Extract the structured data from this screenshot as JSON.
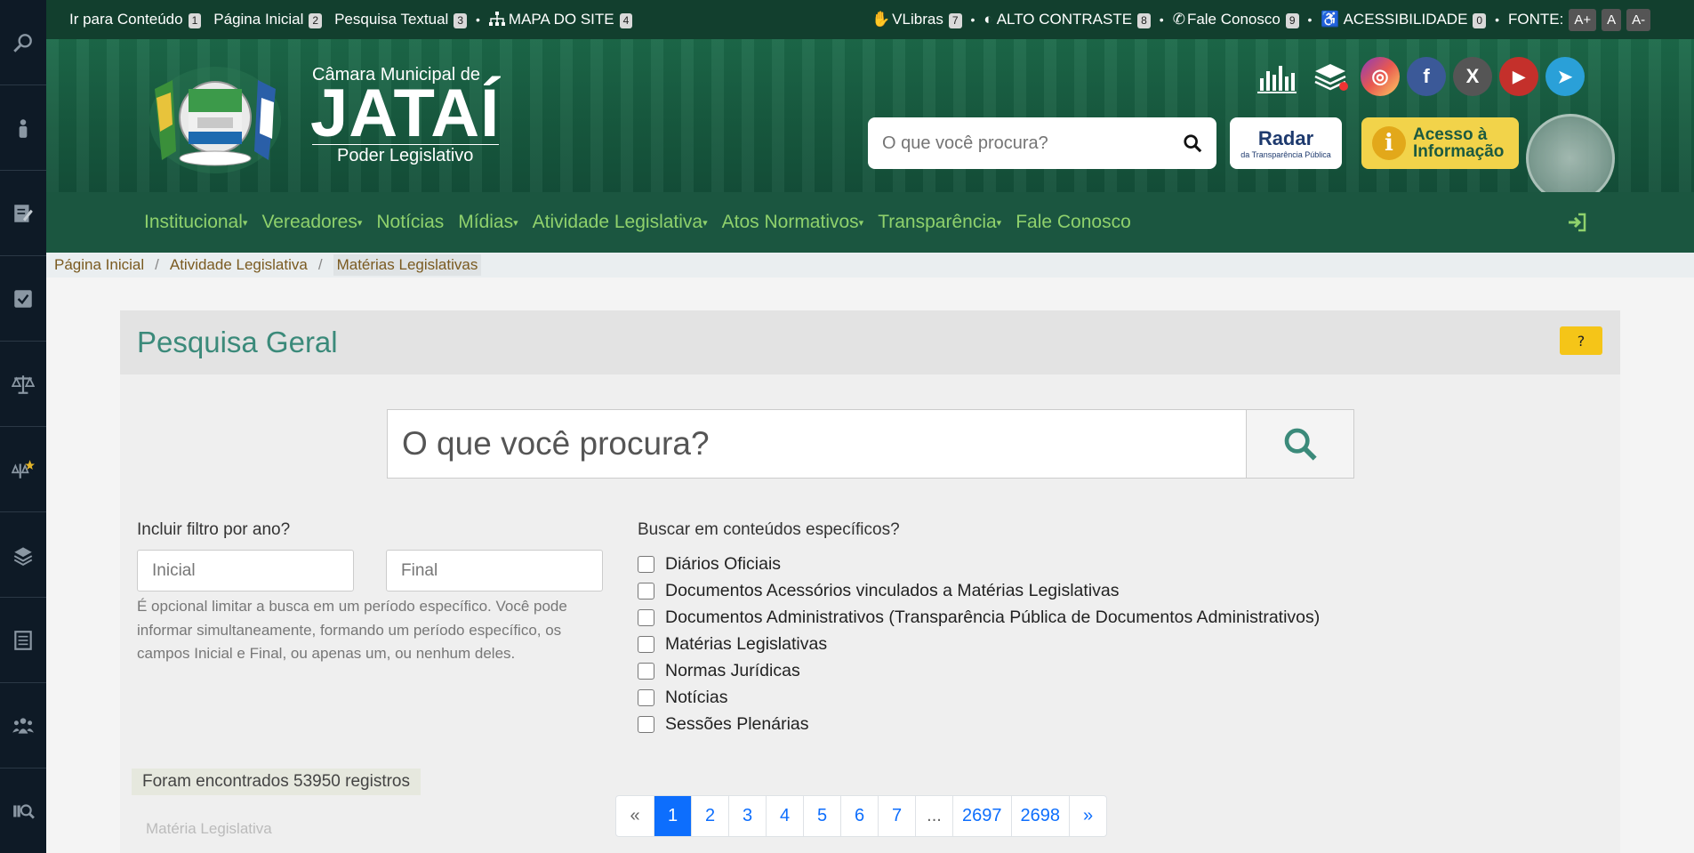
{
  "topbar": {
    "skip": "Ir para Conteúdo",
    "skip_key": "1",
    "home": "Página Inicial",
    "home_key": "2",
    "textual": "Pesquisa Textual",
    "textual_key": "3",
    "sitemap": "MAPA DO SITE",
    "sitemap_key": "4",
    "vlibras": "VLibras",
    "vlibras_key": "7",
    "contrast": "ALTO CONTRASTE",
    "contrast_key": "8",
    "contact": "Fale Conosco",
    "contact_key": "9",
    "access": "ACESSIBILIDADE",
    "access_key": "0",
    "font_label": "FONTE:",
    "font_plus": "A+",
    "font_normal": "A",
    "font_minus": "A-"
  },
  "brand": {
    "sup": "Câmara Municipal de",
    "main": "JATAÍ",
    "sub": "Poder Legislativo"
  },
  "header_search": {
    "placeholder": "O que você procura?"
  },
  "radar": {
    "title": "Radar",
    "subtitle": "da Transparência Pública"
  },
  "acesso": {
    "line1": "Acesso à",
    "line2": "Informação"
  },
  "nav": {
    "items": [
      {
        "label": "Institucional",
        "caret": "▾"
      },
      {
        "label": "Vereadores",
        "caret": "▾"
      },
      {
        "label": "Notícias",
        "caret": ""
      },
      {
        "label": "Mídias",
        "caret": "▾"
      },
      {
        "label": "Atividade Legislativa",
        "caret": "▾"
      },
      {
        "label": "Atos Normativos",
        "caret": "▾"
      },
      {
        "label": "Transparência",
        "caret": "▾"
      },
      {
        "label": "Fale Conosco",
        "caret": ""
      }
    ]
  },
  "breadcrumb": {
    "items": [
      "Página Inicial",
      "Atividade Legislativa",
      "Matérias Legislativas"
    ],
    "sep": "/"
  },
  "search": {
    "title": "Pesquisa Geral",
    "help": "?",
    "placeholder": "O que você procura?",
    "year_label": "Incluir filtro por ano?",
    "year_start": "Inicial",
    "year_end": "Final",
    "hint": "É opcional limitar a busca em um período específico. Você pode informar simultaneamente, formando um período específico, os campos Inicial e Final, ou apenas um, ou nenhum deles.",
    "content_label": "Buscar em conteúdos específicos?",
    "options": [
      "Diários Oficiais",
      "Documentos Acessórios vinculados a Matérias Legislativas",
      "Documentos Administrativos (Transparência Pública de Documentos Administrativos)",
      "Matérias Legislativas",
      "Normas Jurídicas",
      "Notícias",
      "Sessões Plenárias"
    ]
  },
  "results": {
    "found": "Foram encontrados 53950 registros",
    "row_hint": "Matéria Legislativa"
  },
  "pagination": {
    "prev": "«",
    "pages": [
      "1",
      "2",
      "3",
      "4",
      "5",
      "6",
      "7",
      "...",
      "2697",
      "2698"
    ],
    "next": "»",
    "active": "1"
  },
  "colors": {
    "topbar": "#123f2e",
    "header": "#1c6a4a",
    "nav": "#1b5640",
    "nav_link": "#8fd16c",
    "title": "#3b8a7a",
    "accent": "#0d6efd",
    "help": "#f5c518"
  },
  "icons": [
    "search-icon",
    "user-icon",
    "edit-icon",
    "check-icon",
    "scales-icon",
    "scales-star-icon",
    "layers-icon",
    "document-icon",
    "people-icon",
    "search-list-icon",
    "sitemap-icon",
    "hand-icon",
    "contrast-icon",
    "phone-icon",
    "wheelchair-icon",
    "chart-icon",
    "layers-pin-icon",
    "instagram-icon",
    "facebook-icon",
    "x-icon",
    "youtube-icon",
    "telegram-icon",
    "login-icon"
  ]
}
